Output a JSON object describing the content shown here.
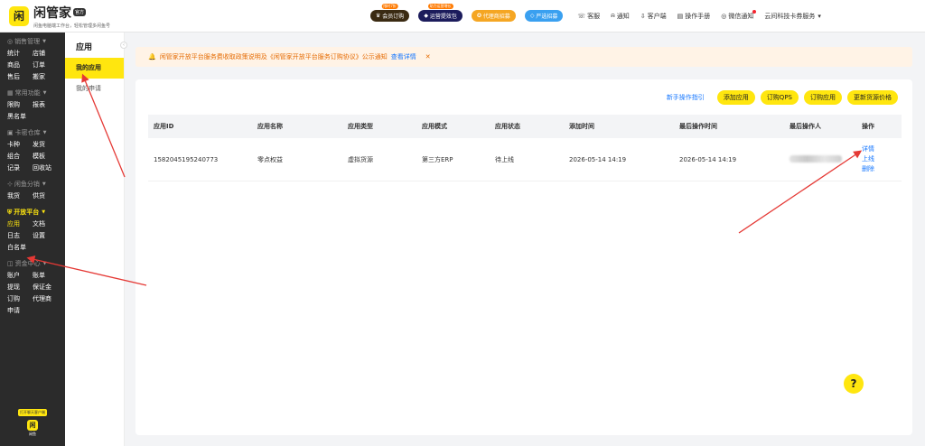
{
  "brand": {
    "title": "闲管家",
    "badge": "官方",
    "subtitle": "闲鱼电脑端工作台，轻松管理多闲鱼号"
  },
  "top_promos": [
    {
      "label": "会员订购",
      "tag": "限时7折",
      "color": "#3a2a12"
    },
    {
      "label": "运营提效包",
      "tag": "助力运营增长",
      "color": "#1c1c5c"
    },
    {
      "label": "代理商招募",
      "tag": "",
      "color": "#f5a623"
    },
    {
      "label": "严选招募",
      "tag": "",
      "color": "#3aa0f0"
    }
  ],
  "top_links": [
    {
      "label": "客服",
      "icon": "headset-icon",
      "glyph": "☏"
    },
    {
      "label": "通知",
      "icon": "bell-icon",
      "glyph": "♫"
    },
    {
      "label": "客户端",
      "icon": "download-icon",
      "glyph": "⇩"
    },
    {
      "label": "操作手册",
      "icon": "book-icon",
      "glyph": "▤"
    },
    {
      "label": "微信通知",
      "icon": "wechat-icon",
      "glyph": "◎"
    },
    {
      "label": "云间科技卡券服务",
      "icon": "chevron-down-icon",
      "glyph": "▾"
    }
  ],
  "sidebar": {
    "groups": [
      {
        "title": "销售管理",
        "icon": "sales-icon",
        "glyph": "◎",
        "items": [
          "统计",
          "店铺",
          "商品",
          "订单",
          "售后",
          "搬家"
        ]
      },
      {
        "title": "常用功能",
        "icon": "grid-icon",
        "glyph": "▦",
        "items": [
          "限购",
          "报表",
          "黑名单"
        ]
      },
      {
        "title": "卡密仓库",
        "icon": "card-icon",
        "glyph": "▣",
        "items": [
          "卡种",
          "发货",
          "组合",
          "模板",
          "记录",
          "回收站"
        ]
      },
      {
        "title": "闲鱼分销",
        "icon": "share-icon",
        "glyph": "⊹",
        "items": [
          "我货",
          "供货"
        ]
      },
      {
        "title": "开放平台",
        "icon": "shield-icon",
        "glyph": "⛨",
        "items": [
          "应用",
          "文档",
          "日志",
          "设置",
          "白名单"
        ],
        "active": true
      },
      {
        "title": "资金中心",
        "icon": "wallet-icon",
        "glyph": "◫",
        "items": [
          "账户",
          "账单",
          "提现",
          "保证金",
          "订购",
          "代理商",
          "申请"
        ]
      }
    ],
    "chat_button": "打开聊天客户端",
    "bottom_label": "闲鱼"
  },
  "subsidebar": {
    "title": "应用",
    "items": [
      "我的应用",
      "我的申请"
    ],
    "collapse_glyph": "‹"
  },
  "notice": {
    "text": "闲管家开放平台服务费收取政策说明及《闲管家开放平台服务订购协议》公示通知",
    "link": "查看详情",
    "close": "✕"
  },
  "toolbar": {
    "guide": "新手操作指引",
    "buttons": [
      "添加应用",
      "订购QPS",
      "订购应用",
      "更新货源价格"
    ]
  },
  "table": {
    "columns": [
      "应用ID",
      "应用名称",
      "应用类型",
      "应用模式",
      "应用状态",
      "添加时间",
      "最后操作时间",
      "最后操作人",
      "操作"
    ],
    "rows": [
      {
        "app_id": "1582045195240773",
        "name": "零点权益",
        "type": "虚拟货源",
        "mode": "第三方ERP",
        "status": "待上线",
        "created": "2026-05-14 14:19",
        "updated": "2026-05-14 14:19",
        "operator": "",
        "ops": [
          "详情",
          "上线",
          "删除"
        ]
      }
    ]
  },
  "help": "?",
  "colors": {
    "accent": "#ffe60f",
    "link": "#1677ff",
    "sidebar_bg": "#2b2b2b",
    "notice_bg": "#fff3e6",
    "annotation_arrow": "#e53935"
  }
}
